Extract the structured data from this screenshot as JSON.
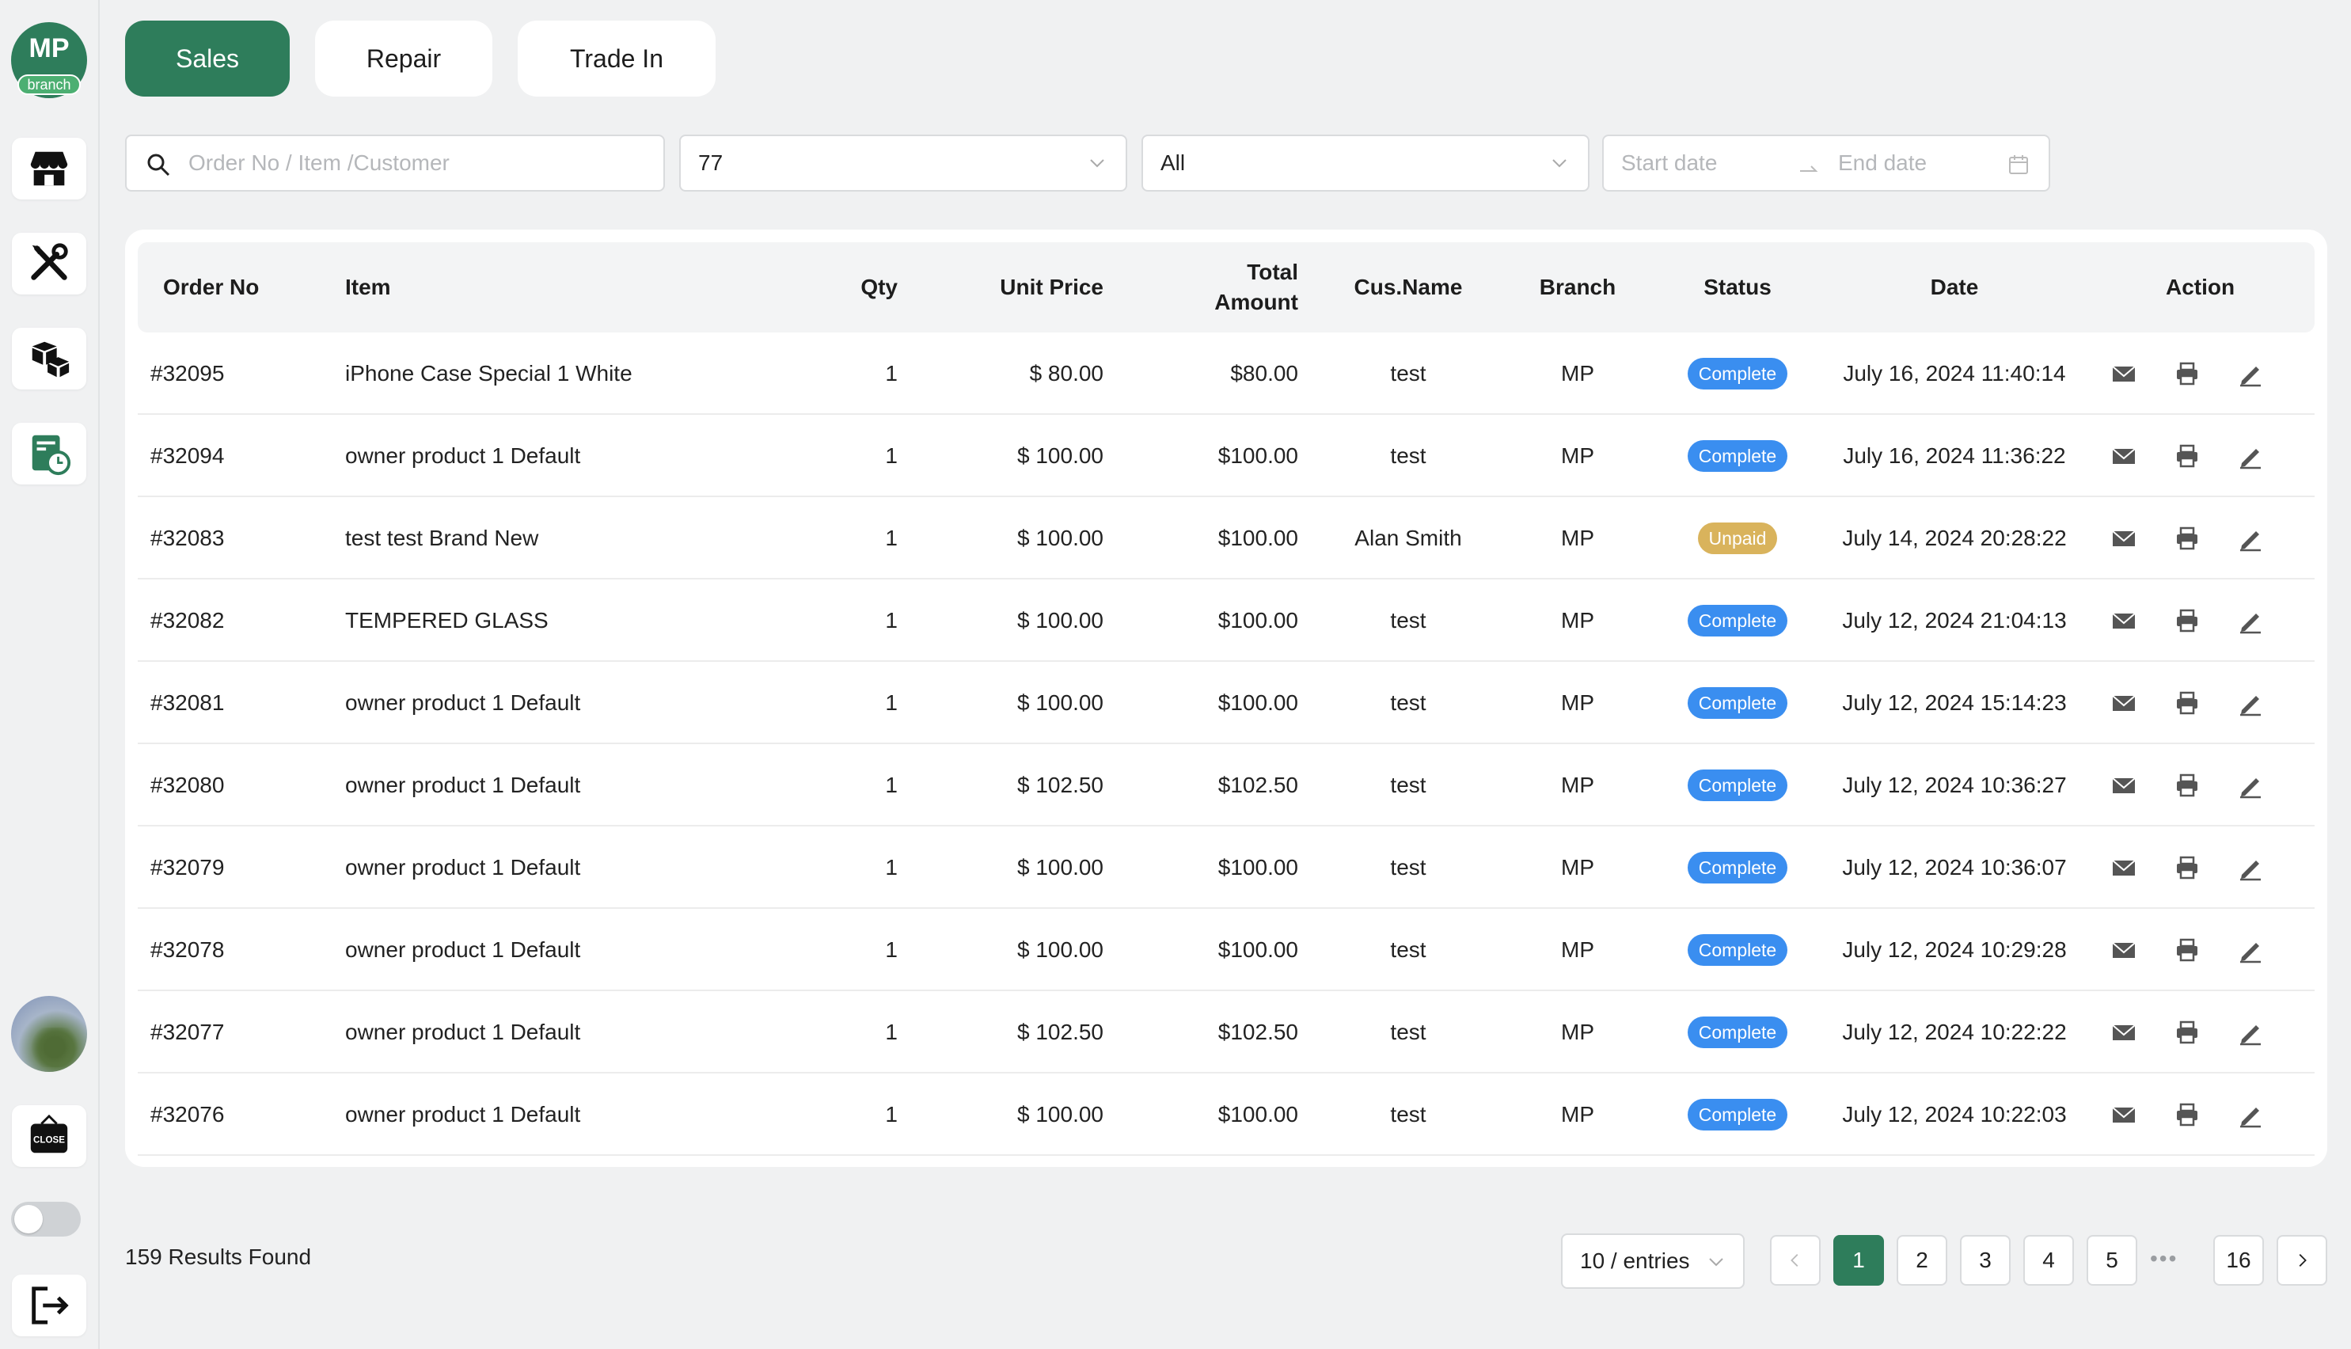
{
  "sidebar": {
    "logo_text": "MP",
    "logo_badge": "branch",
    "close_sign_text": "CLOSE",
    "icons": [
      "store-icon",
      "repair-tools-icon",
      "boxes-icon",
      "report-clock-icon",
      "logout-icon"
    ]
  },
  "tabs": [
    {
      "label": "Sales",
      "active": true
    },
    {
      "label": "Repair",
      "active": false
    },
    {
      "label": "Trade In",
      "active": false
    }
  ],
  "filters": {
    "search_placeholder": "Order No / Item /Customer",
    "select1_value": "77",
    "select2_value": "All",
    "start_date_placeholder": "Start date",
    "end_date_placeholder": "End date"
  },
  "table": {
    "headers": {
      "order_no": "Order No",
      "item": "Item",
      "qty": "Qty",
      "unit_price": "Unit Price",
      "total_amount_1": "Total",
      "total_amount_2": "Amount",
      "cus_name": "Cus.Name",
      "branch": "Branch",
      "status": "Status",
      "date": "Date",
      "action": "Action"
    },
    "rows": [
      {
        "order": "#32095",
        "item": "iPhone Case Special 1 White",
        "qty": "1",
        "unit": "$ 80.00",
        "total": "$80.00",
        "customer": "test",
        "branch": "MP",
        "status": "Complete",
        "date": "July 16, 2024 11:40:14"
      },
      {
        "order": "#32094",
        "item": "owner product 1 Default",
        "qty": "1",
        "unit": "$ 100.00",
        "total": "$100.00",
        "customer": "test",
        "branch": "MP",
        "status": "Complete",
        "date": "July 16, 2024 11:36:22"
      },
      {
        "order": "#32083",
        "item": "test test Brand New",
        "qty": "1",
        "unit": "$ 100.00",
        "total": "$100.00",
        "customer": "Alan Smith",
        "branch": "MP",
        "status": "Unpaid",
        "date": "July 14, 2024 20:28:22"
      },
      {
        "order": "#32082",
        "item": "TEMPERED GLASS",
        "qty": "1",
        "unit": "$ 100.00",
        "total": "$100.00",
        "customer": "test",
        "branch": "MP",
        "status": "Complete",
        "date": "July 12, 2024 21:04:13"
      },
      {
        "order": "#32081",
        "item": "owner product 1 Default",
        "qty": "1",
        "unit": "$ 100.00",
        "total": "$100.00",
        "customer": "test",
        "branch": "MP",
        "status": "Complete",
        "date": "July 12, 2024 15:14:23"
      },
      {
        "order": "#32080",
        "item": "owner product 1 Default",
        "qty": "1",
        "unit": "$ 102.50",
        "total": "$102.50",
        "customer": "test",
        "branch": "MP",
        "status": "Complete",
        "date": "July 12, 2024 10:36:27"
      },
      {
        "order": "#32079",
        "item": "owner product 1 Default",
        "qty": "1",
        "unit": "$ 100.00",
        "total": "$100.00",
        "customer": "test",
        "branch": "MP",
        "status": "Complete",
        "date": "July 12, 2024 10:36:07"
      },
      {
        "order": "#32078",
        "item": "owner product 1 Default",
        "qty": "1",
        "unit": "$ 100.00",
        "total": "$100.00",
        "customer": "test",
        "branch": "MP",
        "status": "Complete",
        "date": "July 12, 2024 10:29:28"
      },
      {
        "order": "#32077",
        "item": "owner product 1 Default",
        "qty": "1",
        "unit": "$ 102.50",
        "total": "$102.50",
        "customer": "test",
        "branch": "MP",
        "status": "Complete",
        "date": "July 12, 2024 10:22:22"
      },
      {
        "order": "#32076",
        "item": "owner product 1 Default",
        "qty": "1",
        "unit": "$ 100.00",
        "total": "$100.00",
        "customer": "test",
        "branch": "MP",
        "status": "Complete",
        "date": "July 12, 2024 10:22:03"
      }
    ]
  },
  "footer": {
    "results_text": "159 Results Found",
    "entries_value": "10 / entries",
    "pages": [
      "1",
      "2",
      "3",
      "4",
      "5",
      "16"
    ],
    "current_page": "1"
  },
  "colors": {
    "accent": "#2e7d5b",
    "complete": "#3a8ef0",
    "unpaid": "#d9b35c"
  }
}
